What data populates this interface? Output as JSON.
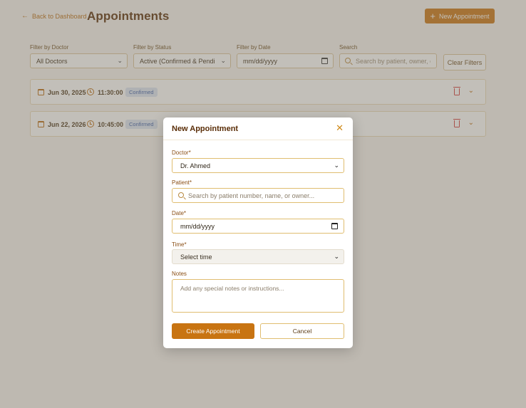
{
  "header": {
    "back_label": "Back to Dashboard",
    "title": "Appointments",
    "new_button_label": "New Appointment"
  },
  "filters": {
    "doctor": {
      "label": "Filter by Doctor",
      "value": "All Doctors"
    },
    "status": {
      "label": "Filter by Status",
      "value": "Active (Confirmed & Pending"
    },
    "date": {
      "label": "Filter by Date",
      "value": "mm/dd/yyyy"
    },
    "search": {
      "label": "Search",
      "placeholder": "Search by patient, owner, or c"
    },
    "clear_label": "Clear Filters"
  },
  "appointments": [
    {
      "date": "Jun 30, 2025",
      "time": "11:30:00",
      "status": "Confirmed"
    },
    {
      "date": "Jun 22, 2026",
      "time": "10:45:00",
      "status": "Confirmed"
    }
  ],
  "modal": {
    "title": "New Appointment",
    "doctor": {
      "label": "Doctor*",
      "value": "Dr. Ahmed"
    },
    "patient": {
      "label": "Patient*",
      "placeholder": "Search by patient number, name, or owner..."
    },
    "date": {
      "label": "Date*",
      "value": "mm/dd/yyyy"
    },
    "time": {
      "label": "Time*",
      "value": "Select time"
    },
    "notes": {
      "label": "Notes",
      "placeholder": "Add any special notes or instructions..."
    },
    "create_label": "Create Appointment",
    "cancel_label": "Cancel"
  },
  "colors": {
    "accent": "#c87412",
    "title": "#5a2e08",
    "badge_bg": "#dde6f5",
    "badge_text": "#3b5ea8",
    "delete": "#d23a3a"
  }
}
